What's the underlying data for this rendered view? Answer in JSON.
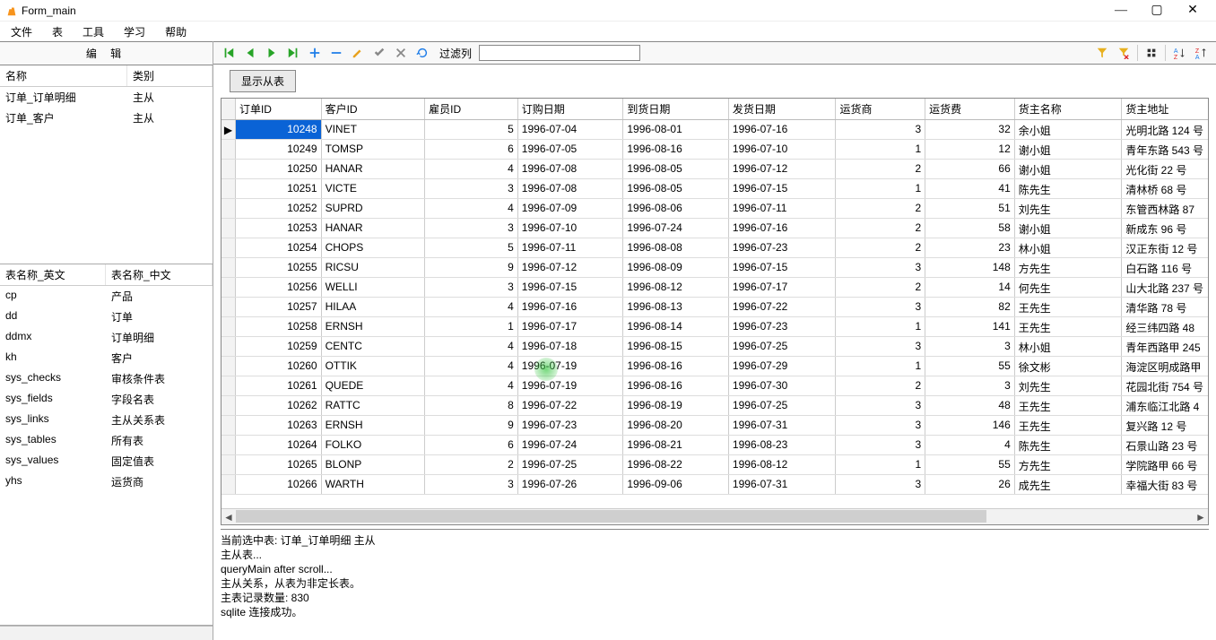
{
  "window": {
    "title": "Form_main"
  },
  "menu": {
    "file": "文件",
    "table": "表",
    "tools": "工具",
    "learn": "学习",
    "help": "帮助"
  },
  "left": {
    "edit_header": "编  辑",
    "upper": {
      "col_name": "名称",
      "col_cat": "类别",
      "rows": [
        {
          "name": "订单_订单明细",
          "cat": "主从"
        },
        {
          "name": "订单_客户",
          "cat": "主从"
        }
      ]
    },
    "lower": {
      "col_en": "表名称_英文",
      "col_cn": "表名称_中文",
      "rows": [
        {
          "en": "cp",
          "cn": "产品"
        },
        {
          "en": "dd",
          "cn": "订单"
        },
        {
          "en": "ddmx",
          "cn": "订单明细"
        },
        {
          "en": "kh",
          "cn": "客户"
        },
        {
          "en": "sys_checks",
          "cn": "审核条件表"
        },
        {
          "en": "sys_fields",
          "cn": "字段名表"
        },
        {
          "en": "sys_links",
          "cn": "主从关系表"
        },
        {
          "en": "sys_tables",
          "cn": "所有表"
        },
        {
          "en": "sys_values",
          "cn": "固定值表"
        },
        {
          "en": "yhs",
          "cn": "运货商"
        }
      ]
    }
  },
  "toolbar": {
    "filter_label": "过滤列",
    "show_sub_btn": "显示从表"
  },
  "grid": {
    "headers": {
      "orderid": "订单ID",
      "custid": "客户ID",
      "empid": "雇员ID",
      "orderdate": "订购日期",
      "reqdate": "到货日期",
      "shipdate": "发货日期",
      "shipper": "运货商",
      "freight": "运货费",
      "shipname": "货主名称",
      "shipaddr": "货主地址"
    },
    "rows": [
      {
        "id": "10248",
        "cust": "VINET",
        "emp": "5",
        "od": "1996-07-04",
        "rd": "1996-08-01",
        "sd": "1996-07-16",
        "sh": "3",
        "fr": "32",
        "nm": "余小姐",
        "ad": "光明北路 124 号"
      },
      {
        "id": "10249",
        "cust": "TOMSP",
        "emp": "6",
        "od": "1996-07-05",
        "rd": "1996-08-16",
        "sd": "1996-07-10",
        "sh": "1",
        "fr": "12",
        "nm": "谢小姐",
        "ad": "青年东路 543 号"
      },
      {
        "id": "10250",
        "cust": "HANAR",
        "emp": "4",
        "od": "1996-07-08",
        "rd": "1996-08-05",
        "sd": "1996-07-12",
        "sh": "2",
        "fr": "66",
        "nm": "谢小姐",
        "ad": "光化街 22 号"
      },
      {
        "id": "10251",
        "cust": "VICTE",
        "emp": "3",
        "od": "1996-07-08",
        "rd": "1996-08-05",
        "sd": "1996-07-15",
        "sh": "1",
        "fr": "41",
        "nm": "陈先生",
        "ad": "清林桥 68 号"
      },
      {
        "id": "10252",
        "cust": "SUPRD",
        "emp": "4",
        "od": "1996-07-09",
        "rd": "1996-08-06",
        "sd": "1996-07-11",
        "sh": "2",
        "fr": "51",
        "nm": "刘先生",
        "ad": "东管西林路 87"
      },
      {
        "id": "10253",
        "cust": "HANAR",
        "emp": "3",
        "od": "1996-07-10",
        "rd": "1996-07-24",
        "sd": "1996-07-16",
        "sh": "2",
        "fr": "58",
        "nm": "谢小姐",
        "ad": "新成东 96 号"
      },
      {
        "id": "10254",
        "cust": "CHOPS",
        "emp": "5",
        "od": "1996-07-11",
        "rd": "1996-08-08",
        "sd": "1996-07-23",
        "sh": "2",
        "fr": "23",
        "nm": "林小姐",
        "ad": "汉正东街 12 号"
      },
      {
        "id": "10255",
        "cust": "RICSU",
        "emp": "9",
        "od": "1996-07-12",
        "rd": "1996-08-09",
        "sd": "1996-07-15",
        "sh": "3",
        "fr": "148",
        "nm": "方先生",
        "ad": "白石路 116 号"
      },
      {
        "id": "10256",
        "cust": "WELLI",
        "emp": "3",
        "od": "1996-07-15",
        "rd": "1996-08-12",
        "sd": "1996-07-17",
        "sh": "2",
        "fr": "14",
        "nm": "何先生",
        "ad": "山大北路 237 号"
      },
      {
        "id": "10257",
        "cust": "HILAA",
        "emp": "4",
        "od": "1996-07-16",
        "rd": "1996-08-13",
        "sd": "1996-07-22",
        "sh": "3",
        "fr": "82",
        "nm": "王先生",
        "ad": "清华路 78 号"
      },
      {
        "id": "10258",
        "cust": "ERNSH",
        "emp": "1",
        "od": "1996-07-17",
        "rd": "1996-08-14",
        "sd": "1996-07-23",
        "sh": "1",
        "fr": "141",
        "nm": "王先生",
        "ad": "经三纬四路 48"
      },
      {
        "id": "10259",
        "cust": "CENTC",
        "emp": "4",
        "od": "1996-07-18",
        "rd": "1996-08-15",
        "sd": "1996-07-25",
        "sh": "3",
        "fr": "3",
        "nm": "林小姐",
        "ad": "青年西路甲 245"
      },
      {
        "id": "10260",
        "cust": "OTTIK",
        "emp": "4",
        "od": "1996-07-19",
        "rd": "1996-08-16",
        "sd": "1996-07-29",
        "sh": "1",
        "fr": "55",
        "nm": "徐文彬",
        "ad": "海淀区明成路甲"
      },
      {
        "id": "10261",
        "cust": "QUEDE",
        "emp": "4",
        "od": "1996-07-19",
        "rd": "1996-08-16",
        "sd": "1996-07-30",
        "sh": "2",
        "fr": "3",
        "nm": "刘先生",
        "ad": "花园北街 754 号"
      },
      {
        "id": "10262",
        "cust": "RATTC",
        "emp": "8",
        "od": "1996-07-22",
        "rd": "1996-08-19",
        "sd": "1996-07-25",
        "sh": "3",
        "fr": "48",
        "nm": "王先生",
        "ad": "浦东临江北路 4"
      },
      {
        "id": "10263",
        "cust": "ERNSH",
        "emp": "9",
        "od": "1996-07-23",
        "rd": "1996-08-20",
        "sd": "1996-07-31",
        "sh": "3",
        "fr": "146",
        "nm": "王先生",
        "ad": "复兴路 12 号"
      },
      {
        "id": "10264",
        "cust": "FOLKO",
        "emp": "6",
        "od": "1996-07-24",
        "rd": "1996-08-21",
        "sd": "1996-08-23",
        "sh": "3",
        "fr": "4",
        "nm": "陈先生",
        "ad": "石景山路 23 号"
      },
      {
        "id": "10265",
        "cust": "BLONP",
        "emp": "2",
        "od": "1996-07-25",
        "rd": "1996-08-22",
        "sd": "1996-08-12",
        "sh": "1",
        "fr": "55",
        "nm": "方先生",
        "ad": "学院路甲 66 号"
      },
      {
        "id": "10266",
        "cust": "WARTH",
        "emp": "3",
        "od": "1996-07-26",
        "rd": "1996-09-06",
        "sd": "1996-07-31",
        "sh": "3",
        "fr": "26",
        "nm": "成先生",
        "ad": "幸福大街 83 号"
      }
    ],
    "selected_index": 0
  },
  "log": {
    "lines": [
      "当前选中表: 订单_订单明细 主从",
      "主从表...",
      "queryMain after scroll...",
      "主从关系，从表为非定长表。",
      "主表记录数量: 830",
      "sqlite 连接成功。"
    ]
  }
}
